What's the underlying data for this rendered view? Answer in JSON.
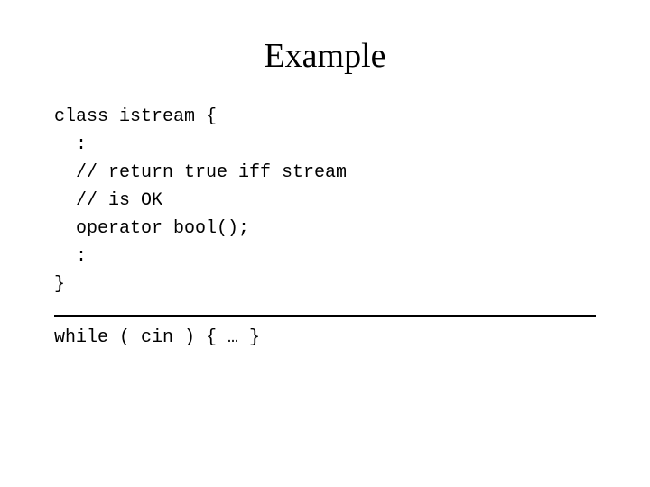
{
  "slide": {
    "title": "Example",
    "code_lines": [
      "class istream {",
      "  :",
      "  // return true iff stream",
      "  // is OK",
      "  operator bool();",
      "  :",
      "}"
    ],
    "while_line": "while ( cin ) { … }"
  }
}
